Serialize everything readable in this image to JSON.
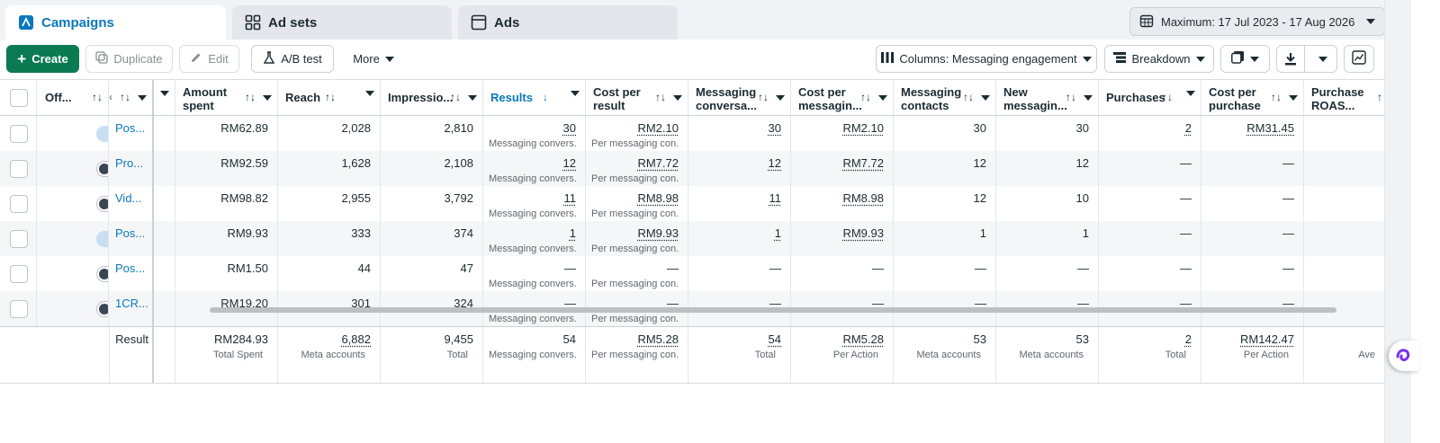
{
  "tabs": [
    {
      "label": "Campaigns",
      "active": true
    },
    {
      "label": "Ad sets",
      "active": false
    },
    {
      "label": "Ads",
      "active": false
    }
  ],
  "date_range": "Maximum: 17 Jul 2023 - 17 Aug 2026",
  "toolbar": {
    "create": "Create",
    "duplicate": "Duplicate",
    "edit": "Edit",
    "ab_test": "A/B test",
    "more": "More",
    "columns": "Columns: Messaging engagement",
    "breakdown": "Breakdown"
  },
  "headers": {
    "status": "Off...",
    "amount": "Amount spent",
    "reach": "Reach",
    "impressions": "Impressio...",
    "results": "Results",
    "cpr": "Cost per result",
    "msg_conv": "Messaging conversa...",
    "cost_msg": "Cost per messagin...",
    "msg_contacts": "Messaging contacts",
    "new_msg": "New messagin...",
    "purchases": "Purchases",
    "cpp": "Cost per purchase",
    "roas": "Purchase ROAS..."
  },
  "rows": [
    {
      "on": true,
      "name": "Pos...",
      "amount": "RM62.89",
      "reach": "2,028",
      "impressions": "2,810",
      "results": "30",
      "results_sub": "Messaging convers...",
      "cpr": "RM2.10",
      "cpr_sub": "Per messaging con...",
      "msg_conv": "30",
      "cost_msg": "RM2.10",
      "msg_contacts": "30",
      "new_msg": "30",
      "purchases": "2",
      "cpp": "RM31.45"
    },
    {
      "on": false,
      "name": "Pro...",
      "amount": "RM92.59",
      "reach": "1,628",
      "impressions": "2,108",
      "results": "12",
      "results_sub": "Messaging convers...",
      "cpr": "RM7.72",
      "cpr_sub": "Per messaging con...",
      "msg_conv": "12",
      "cost_msg": "RM7.72",
      "msg_contacts": "12",
      "new_msg": "12",
      "purchases": "—",
      "cpp": "—"
    },
    {
      "on": false,
      "name": "Vid...",
      "amount": "RM98.82",
      "reach": "2,955",
      "impressions": "3,792",
      "results": "11",
      "results_sub": "Messaging convers...",
      "cpr": "RM8.98",
      "cpr_sub": "Per messaging con...",
      "msg_conv": "11",
      "cost_msg": "RM8.98",
      "msg_contacts": "12",
      "new_msg": "10",
      "purchases": "—",
      "cpp": "—"
    },
    {
      "on": true,
      "name": "Pos...",
      "amount": "RM9.93",
      "reach": "333",
      "impressions": "374",
      "results": "1",
      "results_sub": "Messaging convers...",
      "cpr": "RM9.93",
      "cpr_sub": "Per messaging con...",
      "msg_conv": "1",
      "cost_msg": "RM9.93",
      "msg_contacts": "1",
      "new_msg": "1",
      "purchases": "—",
      "cpp": "—"
    },
    {
      "on": false,
      "name": "Pos...",
      "amount": "RM1.50",
      "reach": "44",
      "impressions": "47",
      "results": "—",
      "results_sub": "Messaging convers...",
      "cpr": "—",
      "cpr_sub": "Per messaging con...",
      "msg_conv": "—",
      "cost_msg": "—",
      "msg_contacts": "—",
      "new_msg": "—",
      "purchases": "—",
      "cpp": "—"
    },
    {
      "on": false,
      "name": "1CR...",
      "amount": "RM19.20",
      "reach": "301",
      "impressions": "324",
      "results": "—",
      "results_sub": "Messaging convers...",
      "cpr": "—",
      "cpr_sub": "Per messaging con...",
      "msg_conv": "—",
      "cost_msg": "—",
      "msg_contacts": "—",
      "new_msg": "—",
      "purchases": "—",
      "cpp": "—"
    }
  ],
  "totals": {
    "label": "Result",
    "amount": "RM284.93",
    "amount_sub": "Total Spent",
    "reach": "6,882",
    "reach_sub": "Meta accounts",
    "impressions": "9,455",
    "impressions_sub": "Total",
    "results": "54",
    "results_sub": "Messaging convers...",
    "cpr": "RM5.28",
    "cpr_sub": "Per messaging con...",
    "msg_conv": "54",
    "msg_conv_sub": "Total",
    "cost_msg": "RM5.28",
    "cost_msg_sub": "Per Action",
    "msg_contacts": "53",
    "msg_contacts_sub": "Meta accounts",
    "new_msg": "53",
    "new_msg_sub": "Meta accounts",
    "purchases": "2",
    "purchases_sub": "Total",
    "cpp": "RM142.47",
    "cpp_sub": "Per Action",
    "roas_sub": "Ave"
  }
}
